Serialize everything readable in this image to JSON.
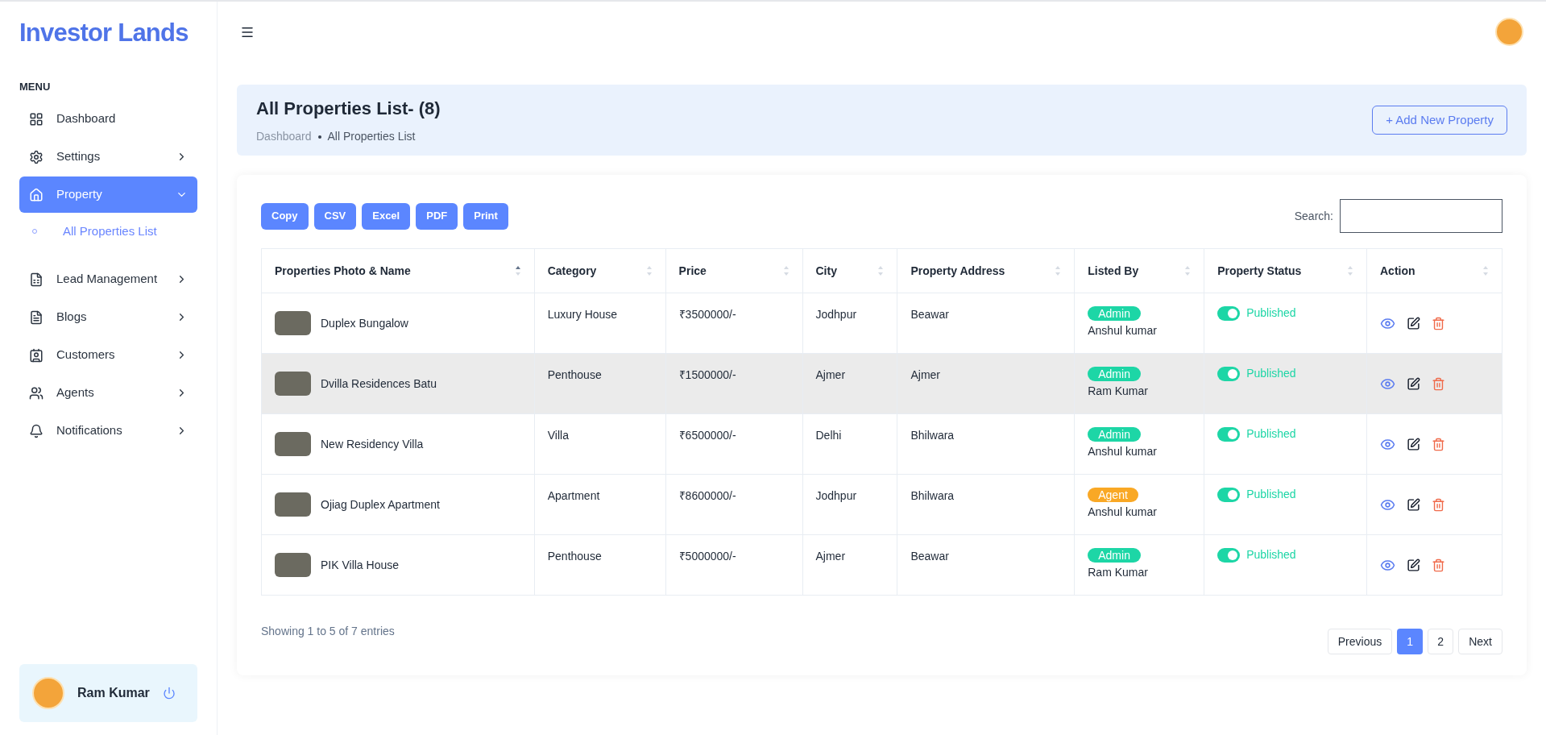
{
  "brand": "Investor Lands",
  "sidebar": {
    "heading": "MENU",
    "items": [
      {
        "label": "Dashboard",
        "has_children": false,
        "expanded": false,
        "selected": false
      },
      {
        "label": "Settings",
        "has_children": true,
        "expanded": false,
        "selected": false
      },
      {
        "label": "Property",
        "has_children": true,
        "expanded": true,
        "selected": true,
        "children": [
          {
            "label": "All Properties List",
            "selected": true
          }
        ]
      },
      {
        "label": "Lead Management",
        "has_children": true,
        "expanded": false,
        "selected": false
      },
      {
        "label": "Blogs",
        "has_children": true,
        "expanded": false,
        "selected": false
      },
      {
        "label": "Customers",
        "has_children": true,
        "expanded": false,
        "selected": false
      },
      {
        "label": "Agents",
        "has_children": true,
        "expanded": false,
        "selected": false
      },
      {
        "label": "Notifications",
        "has_children": true,
        "expanded": false,
        "selected": false
      }
    ],
    "user": {
      "name": "Ram Kumar"
    }
  },
  "page": {
    "title": "All Properties List- (8)",
    "breadcrumb": [
      "Dashboard",
      "All Properties List"
    ],
    "add_button": "+ Add New Property"
  },
  "export_buttons": [
    "Copy",
    "CSV",
    "Excel",
    "PDF",
    "Print"
  ],
  "search": {
    "label": "Search:"
  },
  "table": {
    "columns": [
      {
        "label": "Properties Photo & Name",
        "sorted": true
      },
      {
        "label": "Category",
        "sorted": false
      },
      {
        "label": "Price",
        "sorted": false
      },
      {
        "label": "City",
        "sorted": false
      },
      {
        "label": "Property Address",
        "sorted": false
      },
      {
        "label": "Listed By",
        "sorted": false
      },
      {
        "label": "Property Status",
        "sorted": false
      },
      {
        "label": "Action",
        "sorted": false
      }
    ],
    "rows": [
      {
        "name": "Duplex Bungalow",
        "category": "Luxury House",
        "price": "₹3500000/-",
        "city": "Jodhpur",
        "address": "Beawar",
        "role": "Admin",
        "color": "#1dd6a6",
        "lister": "Anshul kumar",
        "status": "Published",
        "on": true,
        "selected": false
      },
      {
        "name": "Dvilla Residences Batu",
        "category": "Penthouse",
        "price": "₹1500000/-",
        "city": "Ajmer",
        "address": "Ajmer",
        "role": "Admin",
        "color": "#1dd6a6",
        "lister": "Ram Kumar",
        "status": "Published",
        "on": true,
        "selected": true
      },
      {
        "name": "New Residency Villa",
        "category": "Villa",
        "price": "₹6500000/-",
        "city": "Delhi",
        "address": "Bhilwara",
        "role": "Admin",
        "color": "#1dd6a6",
        "lister": "Anshul kumar",
        "status": "Published",
        "on": true,
        "selected": false
      },
      {
        "name": "Ojiag Duplex Apartment",
        "category": "Apartment",
        "price": "₹8600000/-",
        "city": "Jodhpur",
        "address": "Bhilwara",
        "role": "Agent",
        "color": "#f9a825",
        "lister": "Anshul kumar",
        "status": "Published",
        "on": true,
        "selected": false
      },
      {
        "name": "PIK Villa House",
        "category": "Penthouse",
        "price": "₹5000000/-",
        "city": "Ajmer",
        "address": "Beawar",
        "role": "Admin",
        "color": "#1dd6a6",
        "lister": "Ram Kumar",
        "status": "Published",
        "on": true,
        "selected": false
      }
    ]
  },
  "footer": {
    "info": "Showing 1 to 5 of 7 entries",
    "previous": "Previous",
    "next": "Next",
    "pages": [
      {
        "label": "1",
        "selected": true
      },
      {
        "label": "2",
        "selected": false
      }
    ]
  }
}
